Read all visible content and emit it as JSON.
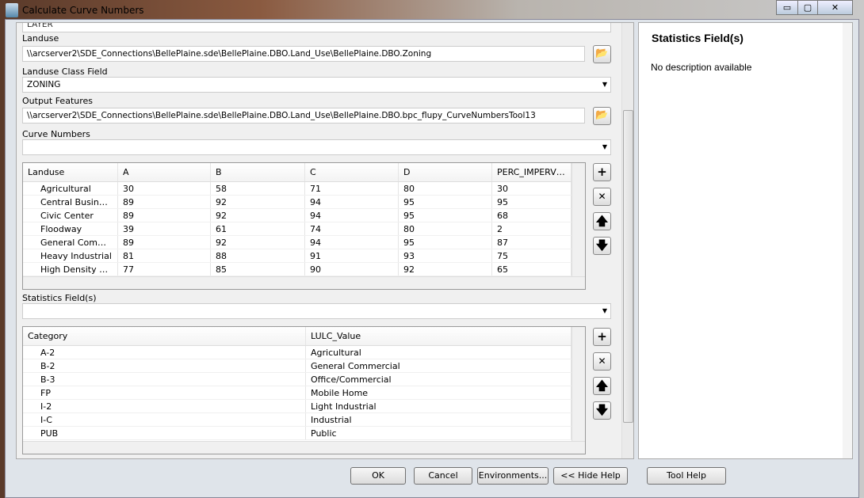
{
  "window": {
    "title": "Calculate Curve Numbers",
    "minimize": "▭",
    "maximize": "▢",
    "close": "✕"
  },
  "form": {
    "clipped_value": "LAYER",
    "landuse": {
      "label": "Landuse",
      "value": "\\\\arcserver2\\SDE_Connections\\BellePlaine.sde\\BellePlaine.DBO.Land_Use\\BellePlaine.DBO.Zoning"
    },
    "landuse_class_field": {
      "label": "Landuse Class Field",
      "value": "ZONING"
    },
    "output_features": {
      "label": "Output Features",
      "value": "\\\\arcserver2\\SDE_Connections\\BellePlaine.sde\\BellePlaine.DBO.Land_Use\\BellePlaine.DBO.bpc_flupy_CurveNumbersTool13"
    },
    "curve_numbers": {
      "label": "Curve Numbers",
      "value": "",
      "columns": [
        "Landuse",
        "A",
        "B",
        "C",
        "D",
        "PERC_IMPERVIOUS"
      ],
      "rows": [
        [
          "Agricultural",
          "30",
          "58",
          "71",
          "80",
          "30"
        ],
        [
          "Central Business",
          "89",
          "92",
          "94",
          "95",
          "95"
        ],
        [
          "Civic Center",
          "89",
          "92",
          "94",
          "95",
          "68"
        ],
        [
          "Floodway",
          "39",
          "61",
          "74",
          "80",
          "2"
        ],
        [
          "General Commercial",
          "89",
          "92",
          "94",
          "95",
          "87"
        ],
        [
          "Heavy Industrial",
          "81",
          "88",
          "91",
          "93",
          "75"
        ],
        [
          "High Density Res...",
          "77",
          "85",
          "90",
          "92",
          "65"
        ]
      ]
    },
    "statistics_fields": {
      "label": "Statistics Field(s)",
      "value": "",
      "columns": [
        "Category",
        "LULC_Value"
      ],
      "rows": [
        [
          "A-2",
          "Agricultural"
        ],
        [
          "B-2",
          "General Commercial"
        ],
        [
          "B-3",
          "Office/Commercial"
        ],
        [
          "FP",
          "Mobile Home"
        ],
        [
          "I-2",
          "Light Industrial"
        ],
        [
          "I-C",
          "Industrial"
        ],
        [
          "PUB",
          "Public"
        ]
      ]
    }
  },
  "row_buttons": {
    "add": "+",
    "remove": "✕",
    "up": "🡅",
    "down": "🡇"
  },
  "help": {
    "title": "Statistics Field(s)",
    "body": "No description available"
  },
  "buttons": {
    "ok": "OK",
    "cancel": "Cancel",
    "environments": "Environments...",
    "hide_help": "<< Hide Help",
    "tool_help": "Tool Help"
  }
}
